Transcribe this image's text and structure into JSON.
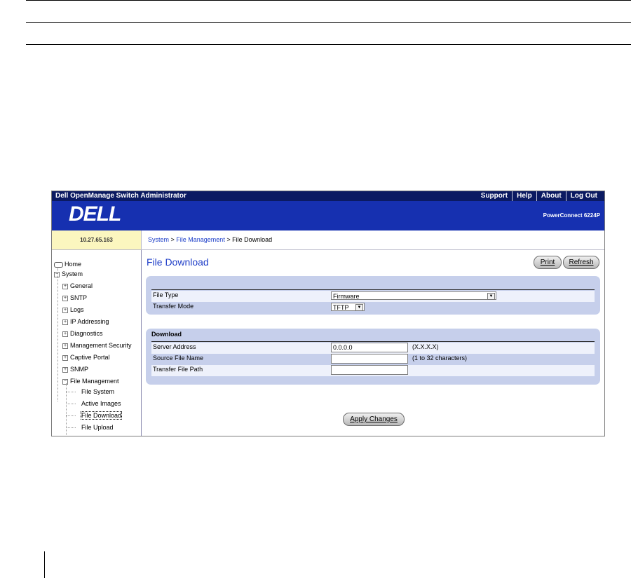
{
  "app": {
    "title": "Dell OpenManage Switch Administrator",
    "links": [
      "Support",
      "Help",
      "About",
      "Log Out"
    ],
    "logo": "DELL",
    "product": "PowerConnect 6224P"
  },
  "ip": "10.27.65.163",
  "breadcrumb": {
    "system": "System",
    "sep1": " > ",
    "file_management": "File Management",
    "sep2": " > ",
    "current": "File Download"
  },
  "sidebar": {
    "home": "Home",
    "system": "System",
    "items": [
      "General",
      "SNTP",
      "Logs",
      "IP Addressing",
      "Diagnostics",
      "Management Security",
      "Captive Portal",
      "SNMP",
      "File Management"
    ],
    "sub_items": [
      "File System",
      "Active Images",
      "File Download",
      "File Upload"
    ]
  },
  "page": {
    "title": "File Download",
    "print_label": "Print",
    "refresh_label": "Refresh",
    "file_type_label": "File Type",
    "file_type_value": "Firmware",
    "transfer_mode_label": "Transfer Mode",
    "transfer_mode_value": "TFTP",
    "download_header": "Download",
    "server_address_label": "Server Address",
    "server_address_value": "0.0.0.0",
    "server_address_hint": "(X.X.X.X)",
    "source_file_label": "Source File Name",
    "source_file_value": "",
    "source_file_hint": "(1 to 32 characters)",
    "transfer_path_label": "Transfer File Path",
    "transfer_path_value": "",
    "apply_label": "Apply Changes"
  }
}
